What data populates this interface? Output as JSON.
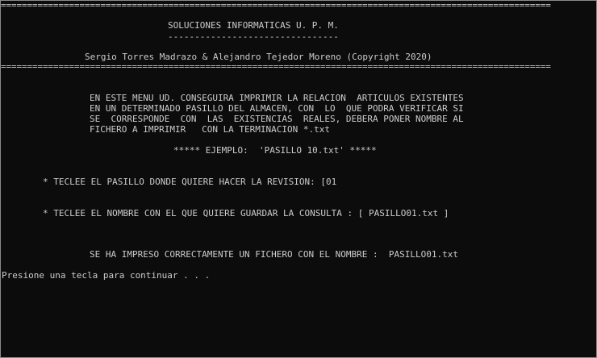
{
  "console": {
    "separator": "=========================================================================================================",
    "company": "SOLUCIONES INFORMATICAS U. P. M.",
    "company_underline": "--------------------------------",
    "authors": "Sergio Torres Madrazo & Alejandro Tejedor Moreno (Copyright 2020)",
    "description": [
      "EN ESTE MENU UD. CONSEGUIRA IMPRIMIR LA RELACION  ARTICULOS EXISTENTES",
      "EN UN DETERMINADO PASILLO DEL ALMACEN, CON  LO  QUE PODRA VERIFICAR SI",
      "SE  CORRESPONDE  CON  LAS  EXISTENCIAS  REALES, DEBERA PONER NOMBRE AL",
      "FICHERO A IMPRIMIR   CON LA TERMINACION *.txt"
    ],
    "example": "***** EJEMPLO:  'PASILLO 10.txt' *****",
    "aisle_prompt": "* TECLEE EL PASILLO DONDE QUIERE HACER LA REVISION: [01",
    "filename_prompt": "* TECLEE EL NOMBRE CON EL QUE QUIERE GUARDAR LA CONSULTA : [ PASILLO01.txt ]",
    "success_message": "SE HA IMPRESO CORRECTAMENTE UN FICHERO CON EL NOMBRE :  PASILLO01.txt",
    "continue_prompt": "Presione una tecla para continuar . . ."
  }
}
